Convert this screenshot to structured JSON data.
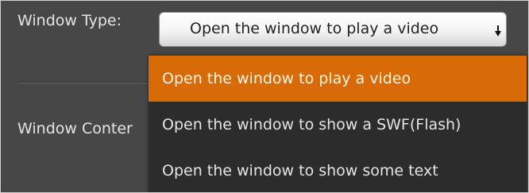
{
  "form": {
    "window_type_label": "Window Type:",
    "window_content_label": "Window Conter"
  },
  "select": {
    "value": "Open the window to play a video",
    "icon": "chevron-down-icon"
  },
  "dropdown": {
    "selected_index": 0,
    "options": [
      {
        "label": "Open the window to play a video"
      },
      {
        "label": "Open the window to show a SWF(Flash)"
      },
      {
        "label": "Open the window to show some text"
      }
    ]
  },
  "colors": {
    "background": "#474747",
    "dropdown_background": "#2c2c2c",
    "highlight": "#d86b07",
    "text": "#e4e4e4"
  }
}
